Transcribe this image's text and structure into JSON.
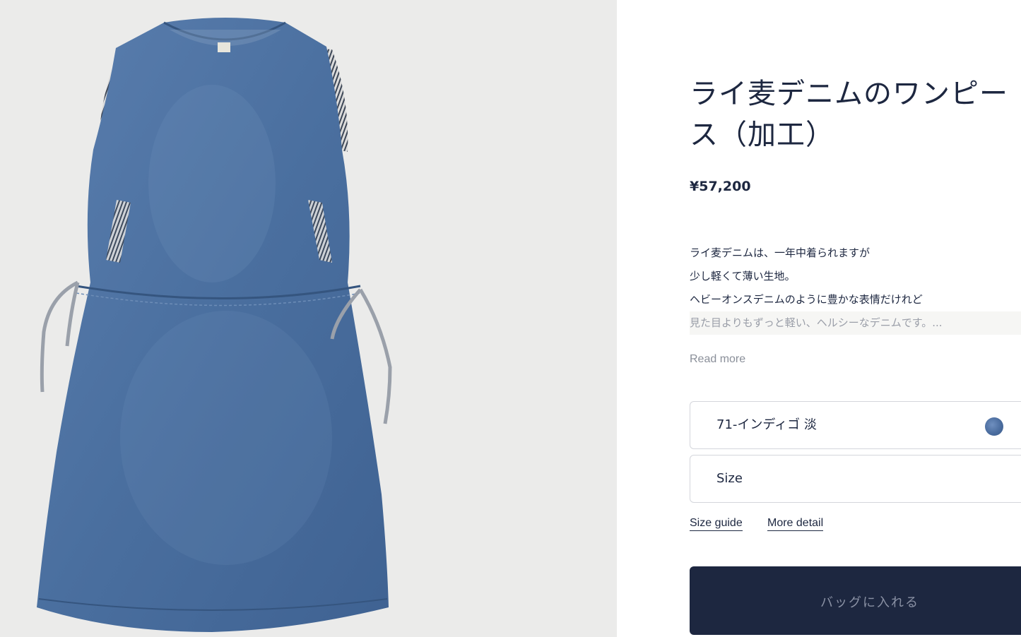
{
  "product": {
    "title_line1": "ライ麦デニムのワンピー",
    "title_line2": "ス（加工）",
    "price": "¥57,200",
    "description_lines": [
      "ライ麦デニムは、一年中着られますが",
      "少し軽くて薄い生地。",
      "ヘビーオンスデニムのように豊かな表情だけれど",
      "見た目よりもずっと軽い、ヘルシーなデニムです。..."
    ],
    "read_more_label": "Read more"
  },
  "options": {
    "color_label": "71-インディゴ 淡",
    "color_swatch": "#4f70a3",
    "size_label": "Size"
  },
  "links": {
    "size_guide": "Size guide",
    "more_detail": "More detail"
  },
  "cart": {
    "add_to_bag_label": "バッグに入れる"
  },
  "colors": {
    "navy": "#1d2740",
    "gallery_bg": "#ebebea",
    "denim": "#4a6f9f"
  }
}
